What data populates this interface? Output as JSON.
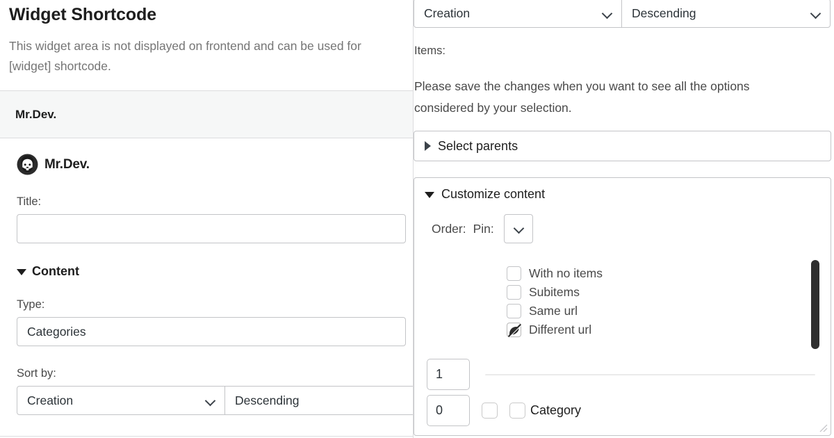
{
  "left": {
    "page_title": "Widget Shortcode",
    "page_description_line1": "This widget area is not displayed on frontend and can be used for",
    "page_description_line2": "[widget] shortcode.",
    "widget": {
      "header_title": "Mr.Dev.",
      "brand_name": "Mr.Dev.",
      "brand_avatar_icon": "bearded-person-avatar-icon",
      "title_field": {
        "label": "Title:",
        "value": "",
        "placeholder": ""
      },
      "content_section": {
        "label": "Content",
        "toggle_icon": "triangle-down-icon",
        "expanded": true
      },
      "type_field": {
        "label": "Type:",
        "value": "Categories"
      },
      "sort_field": {
        "label": "Sort by:",
        "sort_value": "Creation",
        "order_value": "Descending",
        "chevron_icon": "chevron-down-icon"
      }
    }
  },
  "right": {
    "sort_value": "Creation",
    "order_value": "Descending",
    "chevron_icon": "chevron-down-icon",
    "items_label": "Items:",
    "notice_line1": "Please save the changes when you want to see all the options",
    "notice_line2": "considered by your selection.",
    "select_parents": {
      "label": "Select parents",
      "toggle_icon": "triangle-right-icon",
      "expanded": false
    },
    "customize_content": {
      "label": "Customize content",
      "toggle_icon": "triangle-down-icon",
      "expanded": true,
      "order_label": "Order:",
      "pin_label": "Pin:",
      "pin_value": "",
      "pin_chevron_icon": "chevron-down-icon",
      "checkboxes": [
        {
          "label": "With no items",
          "state": "unchecked",
          "icon": "checkbox-empty-icon"
        },
        {
          "label": "Subitems",
          "state": "unchecked",
          "icon": "checkbox-empty-icon"
        },
        {
          "label": "Same url",
          "state": "unchecked",
          "icon": "checkbox-empty-icon"
        },
        {
          "label": "Different url",
          "state": "crossed",
          "icon": "checkbox-slashed-icon"
        }
      ],
      "scrollbar_icon": "vertical-scrollbar-thumb",
      "count_input_value": "1",
      "range_value": "",
      "offset_input_value": "0",
      "extra_checkbox_state": "unchecked",
      "category_checkbox_label": "Category",
      "category_checkbox_state": "unchecked",
      "resize_grip_icon": "resize-handle-icon"
    }
  },
  "colors": {
    "text_primary": "#1e1e1e",
    "text_secondary": "#494949",
    "text_muted": "#757575",
    "border": "#c3c4c7",
    "panel_border": "#dcdcde",
    "header_bg": "#f6f7f7",
    "scroll_thumb": "#2f2f2f"
  }
}
